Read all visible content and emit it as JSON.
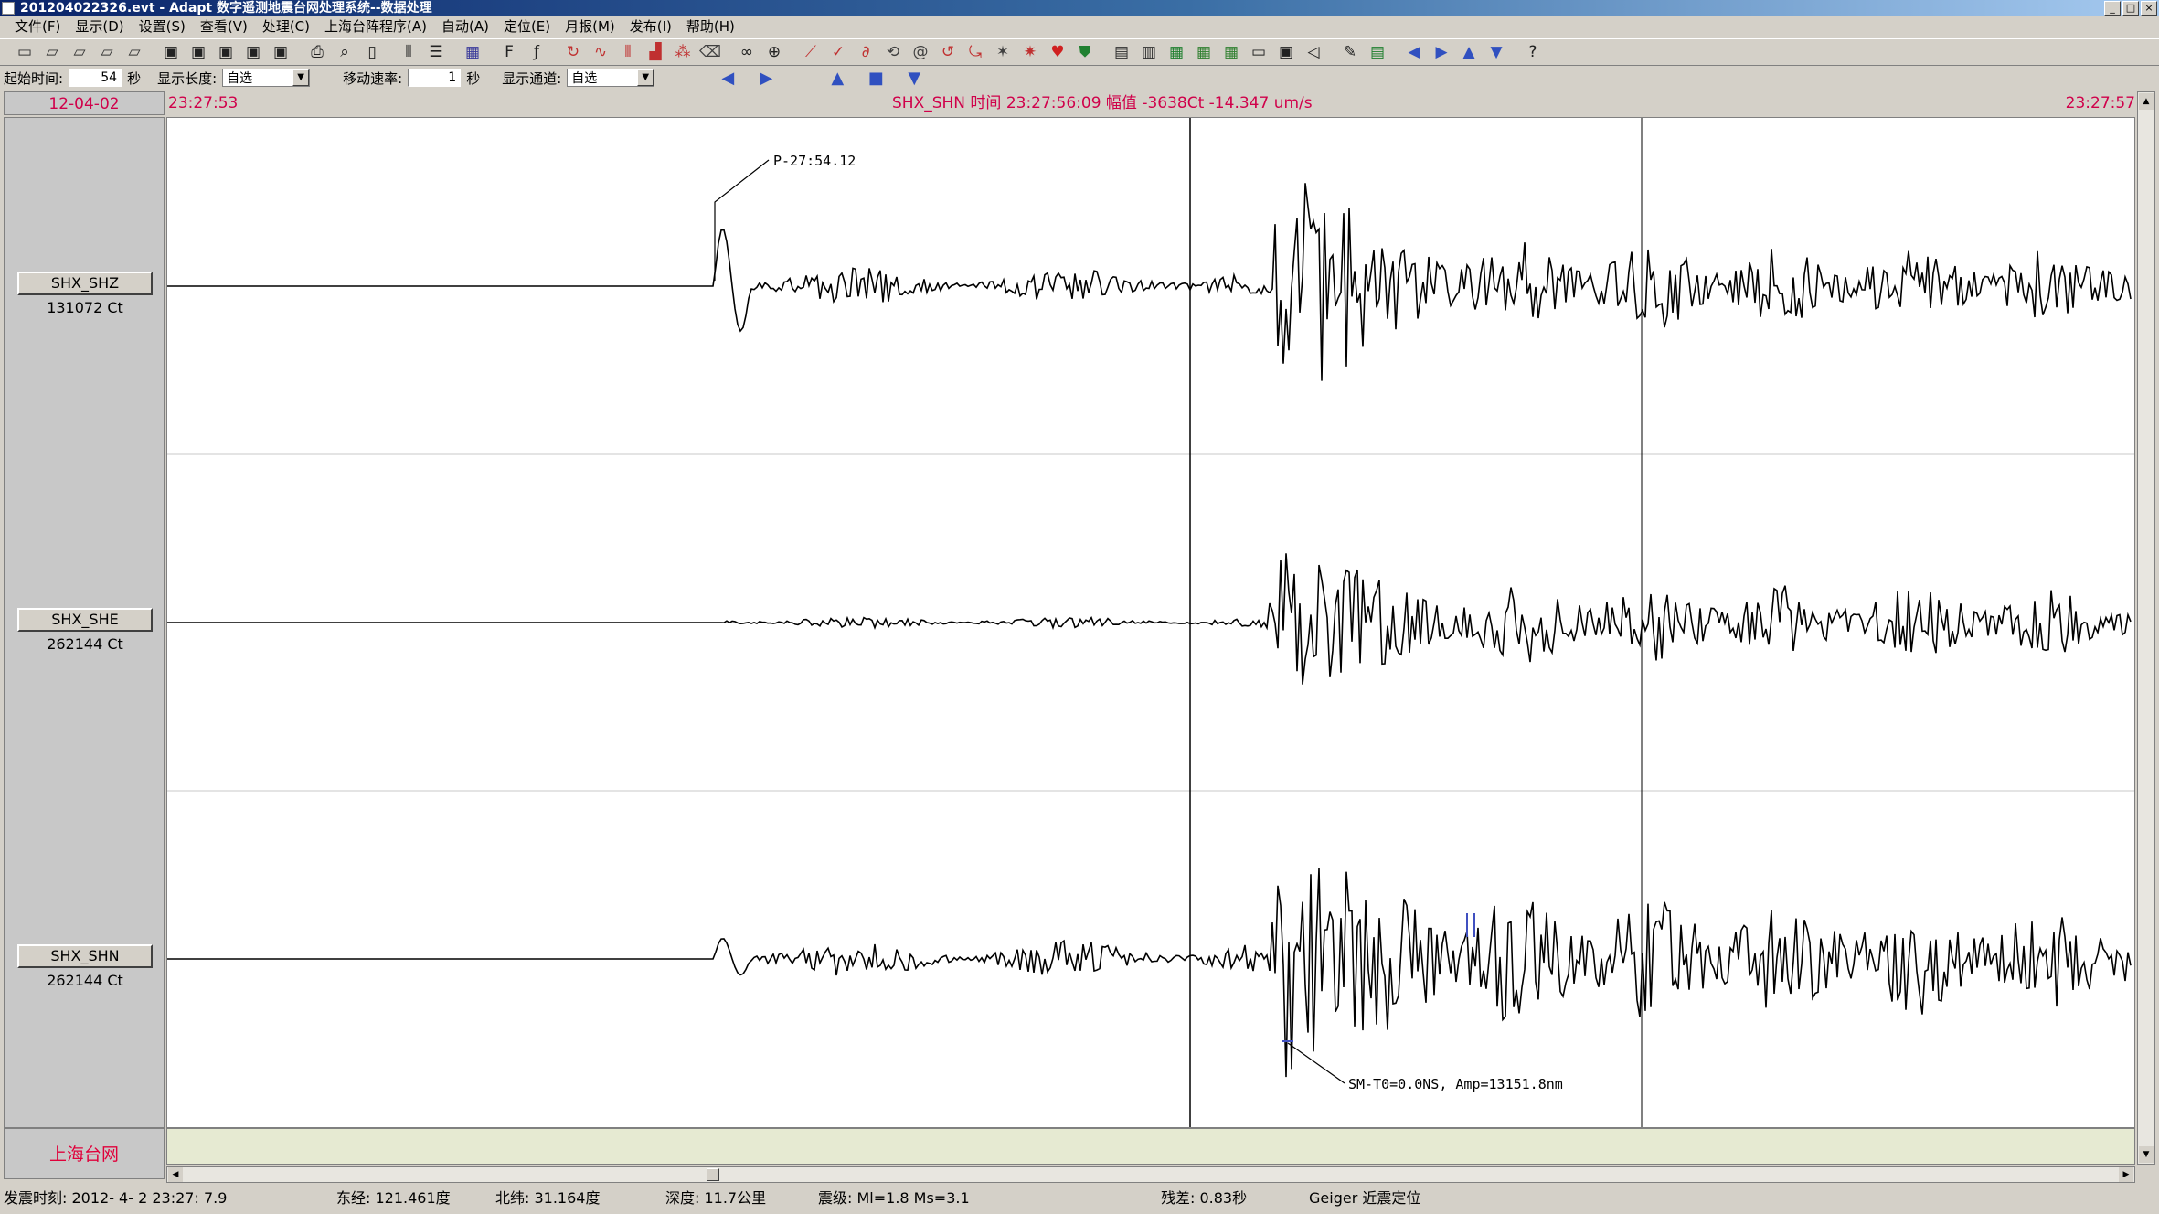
{
  "window": {
    "title": "201204022326.evt - Adapt 数字遥测地震台网处理系统--数据处理",
    "controls": [
      "_",
      "□",
      "×"
    ]
  },
  "menu": [
    "文件(F)",
    "显示(D)",
    "设置(S)",
    "查看(V)",
    "处理(C)",
    "上海台阵程序(A)",
    "自动(A)",
    "定位(E)",
    "月报(M)",
    "发布(I)",
    "帮助(H)"
  ],
  "toolbar": {
    "icons": [
      {
        "name": "new-icon",
        "glyph": "▭",
        "color": "#333333"
      },
      {
        "name": "open-icon",
        "glyph": "▱",
        "color": "#333333"
      },
      {
        "name": "open-folder-icon",
        "glyph": "▱",
        "color": "#333333"
      },
      {
        "name": "open-recent-icon",
        "glyph": "▱",
        "color": "#333333"
      },
      {
        "name": "folder-icon",
        "glyph": "▱",
        "color": "#333333"
      },
      {
        "name": "save-icon",
        "glyph": "▣",
        "color": "#222222"
      },
      {
        "name": "save-all-icon",
        "glyph": "▣",
        "color": "#222222"
      },
      {
        "name": "save-as-icon",
        "glyph": "▣",
        "color": "#222222"
      },
      {
        "name": "disk-icon",
        "glyph": "▣",
        "color": "#222222"
      },
      {
        "name": "disk-alt-icon",
        "glyph": "▣",
        "color": "#222222"
      },
      {
        "name": "print-icon",
        "glyph": "⎙",
        "color": "#222222"
      },
      {
        "name": "print-preview-icon",
        "glyph": "⌕",
        "color": "#222222"
      },
      {
        "name": "page-icon",
        "glyph": "▯",
        "color": "#222222"
      },
      {
        "name": "columns-icon",
        "glyph": "⦀",
        "color": "#222222"
      },
      {
        "name": "list-icon",
        "glyph": "☰",
        "color": "#222222"
      },
      {
        "name": "grid-icon",
        "glyph": "▦",
        "color": "#3a3a9a"
      },
      {
        "name": "filter-f-icon",
        "glyph": "F",
        "color": "#222222"
      },
      {
        "name": "filter-f-italic-icon",
        "glyph": "ƒ",
        "color": "#222222"
      },
      {
        "name": "curve-icon",
        "glyph": "↻",
        "color": "#c03030"
      },
      {
        "name": "wave-icon",
        "glyph": "∿",
        "color": "#c03030"
      },
      {
        "name": "spectrum-icon",
        "glyph": "⫴",
        "color": "#c03030"
      },
      {
        "name": "histogram-icon",
        "glyph": "▟",
        "color": "#c03030"
      },
      {
        "name": "particle-icon",
        "glyph": "⁂",
        "color": "#c03030"
      },
      {
        "name": "eraser-icon",
        "glyph": "⌫",
        "color": "#404040"
      },
      {
        "name": "binoculars-icon",
        "glyph": "∞",
        "color": "#202020"
      },
      {
        "name": "magnifier-icon",
        "glyph": "⊕",
        "color": "#202020"
      },
      {
        "name": "line-tool-icon",
        "glyph": "⟋",
        "color": "#c03030"
      },
      {
        "name": "check-tool-icon",
        "glyph": "✓",
        "color": "#c03030"
      },
      {
        "name": "loop-icon",
        "glyph": "∂",
        "color": "#c03030"
      },
      {
        "name": "rotate-icon",
        "glyph": "⟲",
        "color": "#404040"
      },
      {
        "name": "spiral-icon",
        "glyph": "@",
        "color": "#404040"
      },
      {
        "name": "cycle-icon",
        "glyph": "↺",
        "color": "#c03030"
      },
      {
        "name": "hook-icon",
        "glyph": "⤿",
        "color": "#c03030"
      },
      {
        "name": "star-icon",
        "glyph": "✶",
        "color": "#404040"
      },
      {
        "name": "burst-icon",
        "glyph": "✷",
        "color": "#c03030"
      },
      {
        "name": "heart-icon",
        "glyph": "♥",
        "color": "#d02020"
      },
      {
        "name": "shield-icon",
        "glyph": "⛊",
        "color": "#208030"
      },
      {
        "name": "table-icon",
        "glyph": "▤",
        "color": "#303030"
      },
      {
        "name": "chart-icon",
        "glyph": "▥",
        "color": "#303030"
      },
      {
        "name": "green-grid-icon",
        "glyph": "▦",
        "color": "#208030"
      },
      {
        "name": "layout-icon",
        "glyph": "▦",
        "color": "#308030"
      },
      {
        "name": "panel-icon",
        "glyph": "▦",
        "color": "#308030"
      },
      {
        "name": "window-icon",
        "glyph": "▭",
        "color": "#202020"
      },
      {
        "name": "zoom-box-icon",
        "glyph": "▣",
        "color": "#202020"
      },
      {
        "name": "speaker-icon",
        "glyph": "◁",
        "color": "#202020"
      },
      {
        "name": "pen-icon",
        "glyph": "✎",
        "color": "#202020"
      },
      {
        "name": "book-icon",
        "glyph": "▤",
        "color": "#208030"
      },
      {
        "name": "arrow-left-icon",
        "glyph": "◀",
        "color": "#3050c0"
      },
      {
        "name": "arrow-right-icon",
        "glyph": "▶",
        "color": "#3050c0"
      },
      {
        "name": "arrow-up-icon",
        "glyph": "▲",
        "color": "#3050c0"
      },
      {
        "name": "arrow-down-icon",
        "glyph": "▼",
        "color": "#3050c0"
      },
      {
        "name": "help-icon",
        "glyph": "?",
        "color": "#202020"
      }
    ]
  },
  "options": {
    "start_time_label": "起始时间:",
    "start_time_value": "54",
    "start_time_unit": "秒",
    "display_length_label": "显示长度:",
    "display_length_value": "自选",
    "move_speed_label": "移动速率:",
    "move_speed_value": "1",
    "move_speed_unit": "秒",
    "display_channel_label": "显示通道:",
    "display_channel_value": "自选"
  },
  "info": {
    "date": "12-04-02",
    "start_time": "23:27:53",
    "cursor_info": "SHX_SHN  时间 23:27:56:09  幅值  -3638Ct   -14.347 um/s",
    "end_time": "23:27:57"
  },
  "channels": [
    {
      "name": "SHX_SHZ",
      "gain": "131072 Ct"
    },
    {
      "name": "SHX_SHE",
      "gain": "262144 Ct"
    },
    {
      "name": "SHX_SHN",
      "gain": "262144 Ct"
    }
  ],
  "annotations": {
    "p_pick": "P-27:54.12",
    "amp_pick": "SM-T0=0.0NS, Amp=13151.8nm"
  },
  "network_label": "上海台网",
  "status": {
    "origin_time": "发震时刻:  2012- 4- 2   23:27: 7.9",
    "longitude": "东经: 121.461度",
    "latitude": "北纬: 31.164度",
    "depth": "深度:  11.7公里",
    "magnitude": "震级: Ml=1.8 Ms=3.1",
    "residual": "残差: 0.83秒",
    "method": "Geiger 近震定位"
  },
  "colors": {
    "accent": "#d0004a",
    "trace": "#000000",
    "grid": "#c0c0c0"
  }
}
